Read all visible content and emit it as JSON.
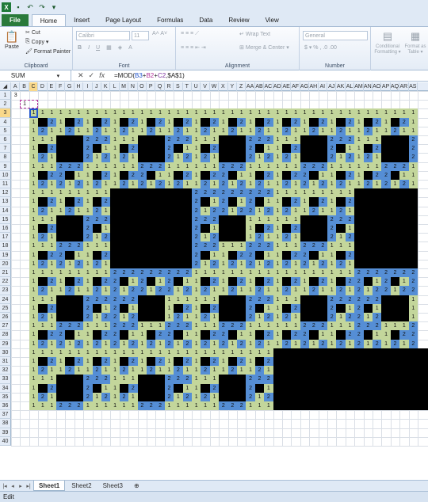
{
  "qat": {
    "app_icon": "X",
    "save_icon": "save-icon",
    "undo_icon": "undo-icon",
    "redo_icon": "redo-icon"
  },
  "tabs": [
    {
      "label": "File"
    },
    {
      "label": "Home"
    },
    {
      "label": "Insert"
    },
    {
      "label": "Page Layout"
    },
    {
      "label": "Formulas"
    },
    {
      "label": "Data"
    },
    {
      "label": "Review"
    },
    {
      "label": "View"
    }
  ],
  "ribbon": {
    "clipboard": {
      "label": "Clipboard",
      "paste": "Paste",
      "cut": "Cut",
      "copy": "Copy ▾",
      "format_painter": "Format Painter"
    },
    "font": {
      "label": "Font",
      "font_name": "Calibri",
      "font_size": "11"
    },
    "alignment": {
      "label": "Alignment",
      "wrap_text": "Wrap Text",
      "merge_center": "Merge & Center ▾"
    },
    "number": {
      "label": "Number",
      "format": "General"
    },
    "styles": {
      "conditional": "Conditional Formatting ▾",
      "format_as": "Format as Table ▾"
    }
  },
  "formula_bar": {
    "name_box": "SUM",
    "formula_prefix": "=MOD(",
    "ref1": "B3",
    "plus1": "+",
    "ref2": "B2",
    "plus2": "+",
    "ref3": "C2",
    "suffix": ",$A$1)"
  },
  "columns": [
    "A",
    "B",
    "C",
    "D",
    "E",
    "F",
    "G",
    "H",
    "I",
    "J",
    "K",
    "L",
    "M",
    "N",
    "O",
    "P",
    "Q",
    "R",
    "S",
    "T",
    "U",
    "V",
    "W",
    "X",
    "Y",
    "Z",
    "AA",
    "AB",
    "AC",
    "AD",
    "AE",
    "AF",
    "AG",
    "AH",
    "AI",
    "AJ",
    "AK",
    "AL",
    "AM",
    "AN",
    "AO",
    "AP",
    "AQ",
    "AR",
    "AS"
  ],
  "rows": [
    "1",
    "2",
    "3",
    "4",
    "5",
    "6",
    "7",
    "8",
    "9",
    "10",
    "11",
    "12",
    "13",
    "14",
    "15",
    "16",
    "17",
    "18",
    "19",
    "20",
    "21",
    "22",
    "23",
    "24",
    "25",
    "26",
    "27",
    "28",
    "29",
    "30",
    "31",
    "32",
    "33",
    "34",
    "35",
    "36",
    "37",
    "38",
    "39",
    "40"
  ],
  "cells": {
    "A1": "3",
    "B2": "1",
    "C3": "1"
  },
  "sheets": [
    {
      "label": "Sheet1"
    },
    {
      "label": "Sheet2"
    },
    {
      "label": "Sheet3"
    }
  ],
  "status": {
    "mode": "Edit"
  },
  "colors": {
    "value1": "#c3d69b",
    "value2": "#558ed5",
    "value0": "#000000",
    "selection": "#2255cc"
  }
}
